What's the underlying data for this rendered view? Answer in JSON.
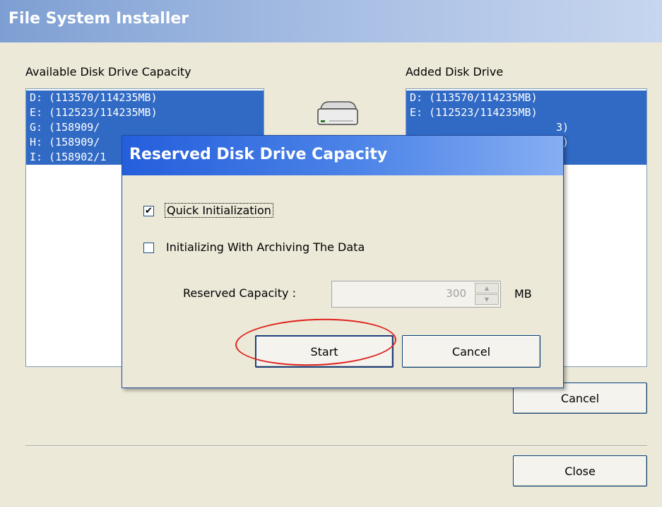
{
  "window": {
    "title": "File System Installer"
  },
  "available": {
    "label": "Available Disk Drive Capacity",
    "items": [
      "D:  (113570/114235MB)",
      "E:  (112523/114235MB)",
      "G:  (158909/",
      "H:  (158909/",
      "I:  (158902/1"
    ]
  },
  "added": {
    "label": "Added Disk Drive",
    "items": [
      "D:  (113570/114235MB)",
      "E:  (112523/114235MB)",
      "",
      "",
      ""
    ],
    "item_tails": [
      "3)",
      "3)",
      ")"
    ]
  },
  "main_buttons": {
    "cancel": "Cancel",
    "close": "Close"
  },
  "dialog": {
    "title": "Reserved Disk Drive Capacity",
    "quick_init": {
      "label": "Quick Initialization",
      "checked": true
    },
    "archive_init": {
      "label": "Initializing With Archiving The Data",
      "checked": false
    },
    "reserved": {
      "label": "Reserved Capacity :",
      "value": "300",
      "unit": "MB"
    },
    "start_label": "Start",
    "cancel_label": "Cancel"
  },
  "icons": {
    "drive": "hard-drive-icon",
    "check": "checkmark-icon"
  },
  "colors": {
    "selection": "#316ac5",
    "annotation": "#e0201c",
    "dialog_title": "#245edb"
  }
}
